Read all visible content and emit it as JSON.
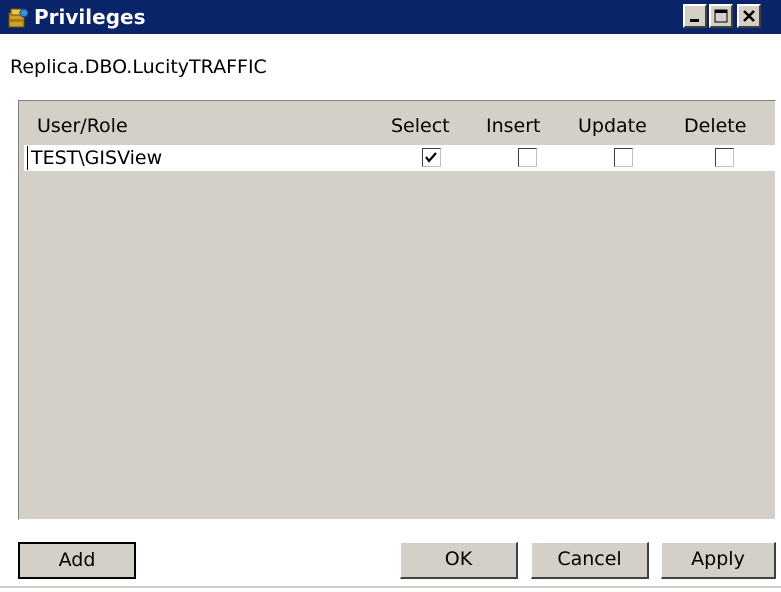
{
  "window": {
    "title": "Privileges",
    "icon": "database-privileges-icon",
    "controls": [
      "minimize-icon",
      "maximize-icon",
      "close-icon"
    ]
  },
  "object_name": "Replica.DBO.LucityTRAFFIC",
  "table": {
    "columns": [
      "User/Role",
      "Select",
      "Insert",
      "Update",
      "Delete"
    ],
    "rows": [
      {
        "user": "TEST\\GISView",
        "select": true,
        "insert": false,
        "update": false,
        "delete": false
      }
    ]
  },
  "buttons": {
    "add": "Add",
    "ok": "OK",
    "cancel": "Cancel",
    "apply": "Apply"
  },
  "colors": {
    "titlebar": "#0a246a",
    "face": "#d4d0c8"
  }
}
